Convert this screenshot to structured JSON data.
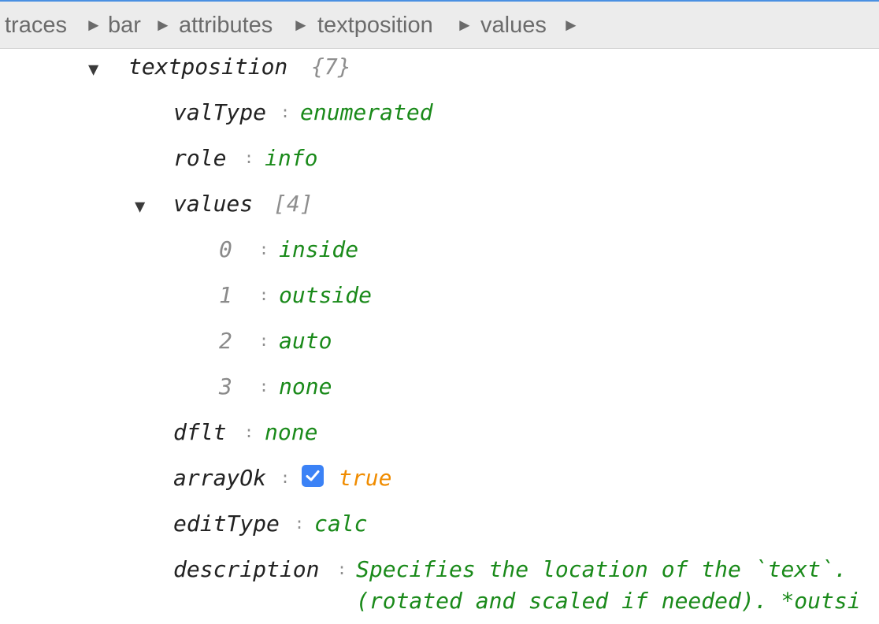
{
  "breadcrumb": {
    "items": [
      "traces",
      "bar",
      "attributes",
      "textposition",
      "values"
    ],
    "separator": "►"
  },
  "tree": {
    "root": {
      "key": "textposition",
      "meta": "{7}",
      "expanded": true
    },
    "valType": {
      "key": "valType",
      "value": "enumerated"
    },
    "role": {
      "key": "role",
      "value": "info"
    },
    "values": {
      "key": "values",
      "meta": "[4]",
      "expanded": true,
      "items": [
        {
          "index": "0",
          "value": "inside"
        },
        {
          "index": "1",
          "value": "outside"
        },
        {
          "index": "2",
          "value": "auto"
        },
        {
          "index": "3",
          "value": "none"
        }
      ]
    },
    "dflt": {
      "key": "dflt",
      "value": "none"
    },
    "arrayOk": {
      "key": "arrayOk",
      "value": "true",
      "checked": true
    },
    "editType": {
      "key": "editType",
      "value": "calc"
    },
    "description": {
      "key": "description",
      "line1": "Specifies the location of the `text`. ",
      "line2": "(rotated and scaled if needed). *outsi"
    }
  },
  "colors": {
    "key": "#222222",
    "value": "#1a8a1a",
    "boolean": "#f08c00",
    "checkbox": "#3b82f6",
    "accent_line": "#4a90e2"
  },
  "icons": {
    "toggle": "triangle-down-icon",
    "separator": "triangle-right-icon",
    "checkbox": "checkbox-checked-icon"
  }
}
